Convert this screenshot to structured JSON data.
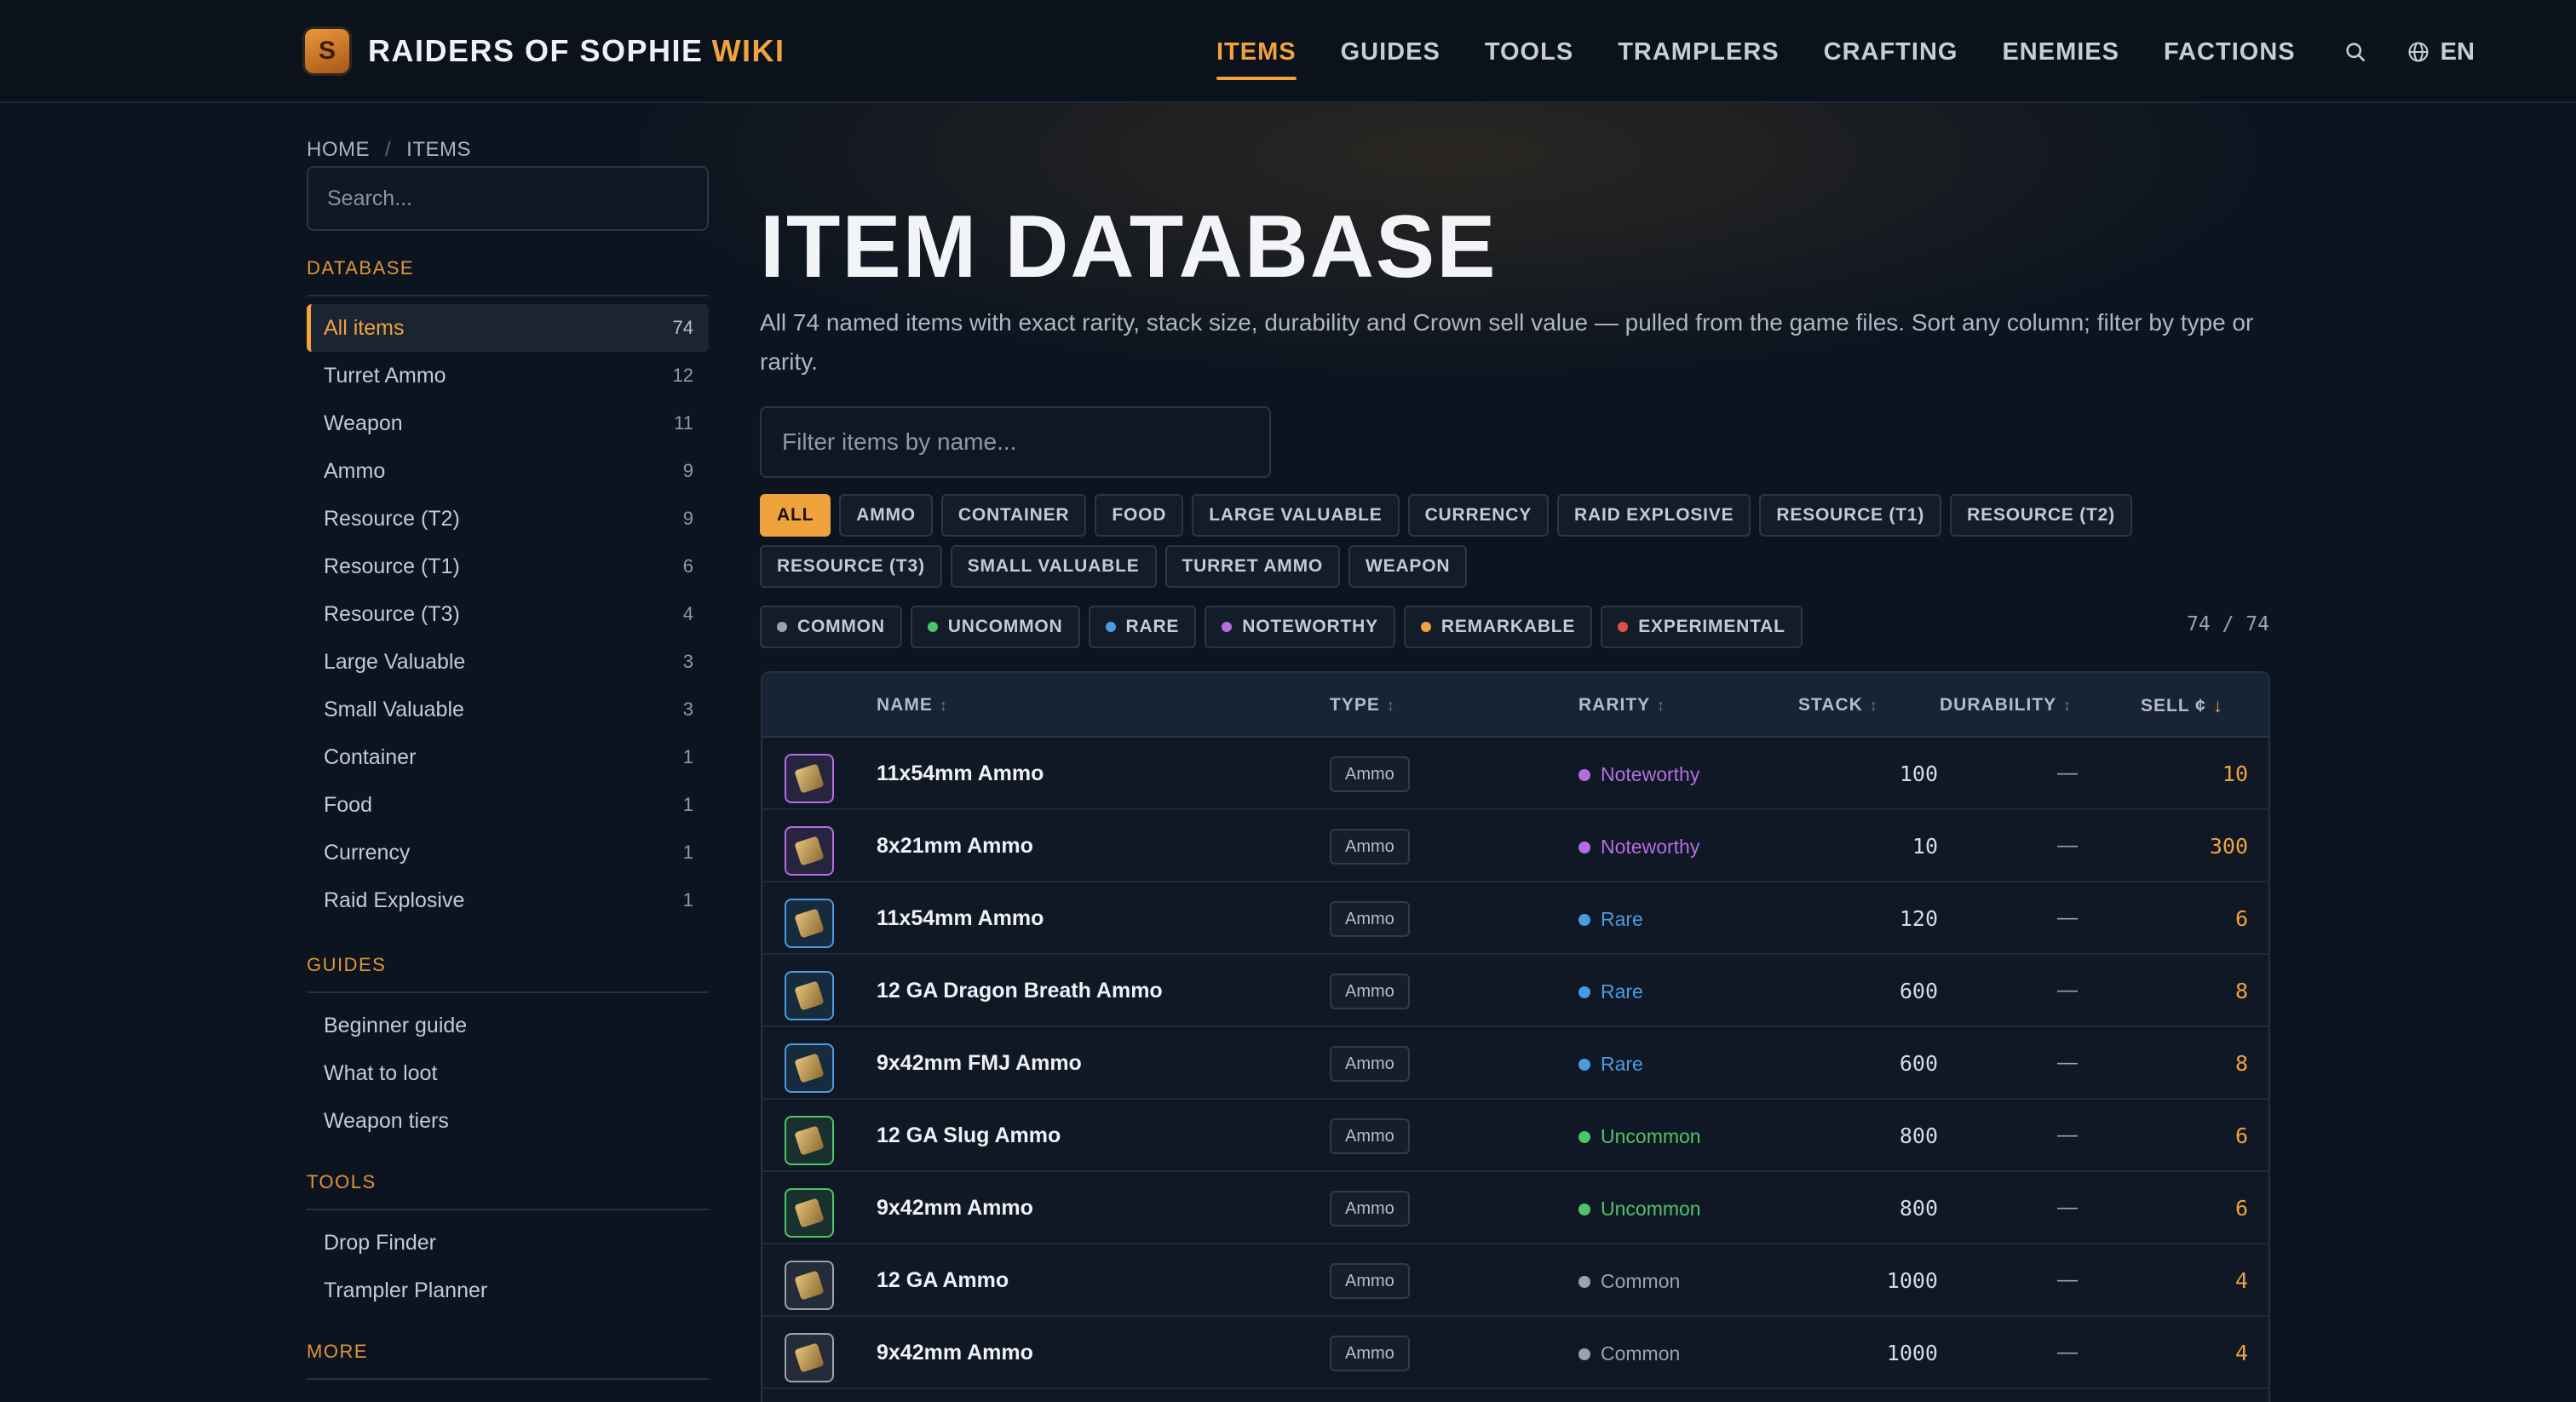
{
  "brand": {
    "name": "RAIDERS OF SOPHIE",
    "accent": "WIKI",
    "logo_letter": "S"
  },
  "nav": {
    "items": [
      "ITEMS",
      "GUIDES",
      "TOOLS",
      "TRAMPLERS",
      "CRAFTING",
      "ENEMIES",
      "FACTIONS"
    ],
    "active": "ITEMS",
    "language": "EN"
  },
  "breadcrumb": {
    "home": "HOME",
    "sep": "/",
    "current": "ITEMS"
  },
  "sidebar": {
    "search_placeholder": "Search...",
    "database_heading": "DATABASE",
    "database_items": [
      {
        "label": "All items",
        "count": "74"
      },
      {
        "label": "Turret Ammo",
        "count": "12"
      },
      {
        "label": "Weapon",
        "count": "11"
      },
      {
        "label": "Ammo",
        "count": "9"
      },
      {
        "label": "Resource (T2)",
        "count": "9"
      },
      {
        "label": "Resource (T1)",
        "count": "6"
      },
      {
        "label": "Resource (T3)",
        "count": "4"
      },
      {
        "label": "Large Valuable",
        "count": "3"
      },
      {
        "label": "Small Valuable",
        "count": "3"
      },
      {
        "label": "Container",
        "count": "1"
      },
      {
        "label": "Food",
        "count": "1"
      },
      {
        "label": "Currency",
        "count": "1"
      },
      {
        "label": "Raid Explosive",
        "count": "1"
      }
    ],
    "guides_heading": "GUIDES",
    "guides_items": [
      "Beginner guide",
      "What to loot",
      "Weapon tiers"
    ],
    "tools_heading": "TOOLS",
    "tools_items": [
      "Drop Finder",
      "Trampler Planner"
    ],
    "more_heading": "MORE"
  },
  "main": {
    "title": "ITEM DATABASE",
    "description": "All 74 named items with exact rarity, stack size, durability and Crown sell value — pulled from the game files. Sort any column; filter by type or rarity.",
    "filter_placeholder": "Filter items by name...",
    "type_filters": [
      "ALL",
      "AMMO",
      "CONTAINER",
      "FOOD",
      "LARGE VALUABLE",
      "CURRENCY",
      "RAID EXPLOSIVE",
      "RESOURCE (T1)",
      "RESOURCE (T2)",
      "RESOURCE (T3)",
      "SMALL VALUABLE",
      "TURRET AMMO",
      "WEAPON"
    ],
    "active_type_filter": "ALL",
    "rarity_filters": [
      {
        "label": "COMMON",
        "color": "#9aa3ad"
      },
      {
        "label": "UNCOMMON",
        "color": "#4ec46a"
      },
      {
        "label": "RARE",
        "color": "#4a9be0"
      },
      {
        "label": "NOTEWORTHY",
        "color": "#b46ee0"
      },
      {
        "label": "REMARKABLE",
        "color": "#f0a23c"
      },
      {
        "label": "EXPERIMENTAL",
        "color": "#e0504a"
      }
    ],
    "result_count": "74 / 74"
  },
  "table": {
    "columns": {
      "name": "NAME",
      "type": "TYPE",
      "rarity": "RARITY",
      "stack": "STACK",
      "durability": "DURABILITY",
      "sell": "SELL ¢"
    },
    "sort_icon": "↕",
    "active_sort_icon": "↓",
    "rows": [
      {
        "icon": "ammo-box-icon",
        "name": "11x54mm Ammo",
        "type": "Ammo",
        "rarity": "Noteworthy",
        "rarity_color": "#b46ee0",
        "stack": "100",
        "durability": "—",
        "sell": "10"
      },
      {
        "icon": "bullet-icon",
        "name": "8x21mm Ammo",
        "type": "Ammo",
        "rarity": "Noteworthy",
        "rarity_color": "#b46ee0",
        "stack": "10",
        "durability": "—",
        "sell": "300"
      },
      {
        "icon": "ammo-box-icon",
        "name": "11x54mm Ammo",
        "type": "Ammo",
        "rarity": "Rare",
        "rarity_color": "#4a9be0",
        "stack": "120",
        "durability": "—",
        "sell": "6"
      },
      {
        "icon": "shell-box-icon",
        "name": "12 GA Dragon Breath Ammo",
        "type": "Ammo",
        "rarity": "Rare",
        "rarity_color": "#4a9be0",
        "stack": "600",
        "durability": "—",
        "sell": "8"
      },
      {
        "icon": "ammo-pack-icon",
        "name": "9x42mm FMJ Ammo",
        "type": "Ammo",
        "rarity": "Rare",
        "rarity_color": "#4a9be0",
        "stack": "600",
        "durability": "—",
        "sell": "8"
      },
      {
        "icon": "shell-box-icon",
        "name": "12 GA Slug Ammo",
        "type": "Ammo",
        "rarity": "Uncommon",
        "rarity_color": "#4ec46a",
        "stack": "800",
        "durability": "—",
        "sell": "6"
      },
      {
        "icon": "ammo-pack-icon",
        "name": "9x42mm Ammo",
        "type": "Ammo",
        "rarity": "Uncommon",
        "rarity_color": "#4ec46a",
        "stack": "800",
        "durability": "—",
        "sell": "6"
      },
      {
        "icon": "shell-box-icon",
        "name": "12 GA Ammo",
        "type": "Ammo",
        "rarity": "Common",
        "rarity_color": "#9aa3ad",
        "stack": "1000",
        "durability": "—",
        "sell": "4"
      },
      {
        "icon": "ammo-pack-icon",
        "name": "9x42mm Ammo",
        "type": "Ammo",
        "rarity": "Common",
        "rarity_color": "#9aa3ad",
        "stack": "1000",
        "durability": "—",
        "sell": "4"
      }
    ]
  },
  "colors": {
    "accent": "#f0a23c",
    "background": "#0c1420",
    "header": "#0b121c"
  }
}
